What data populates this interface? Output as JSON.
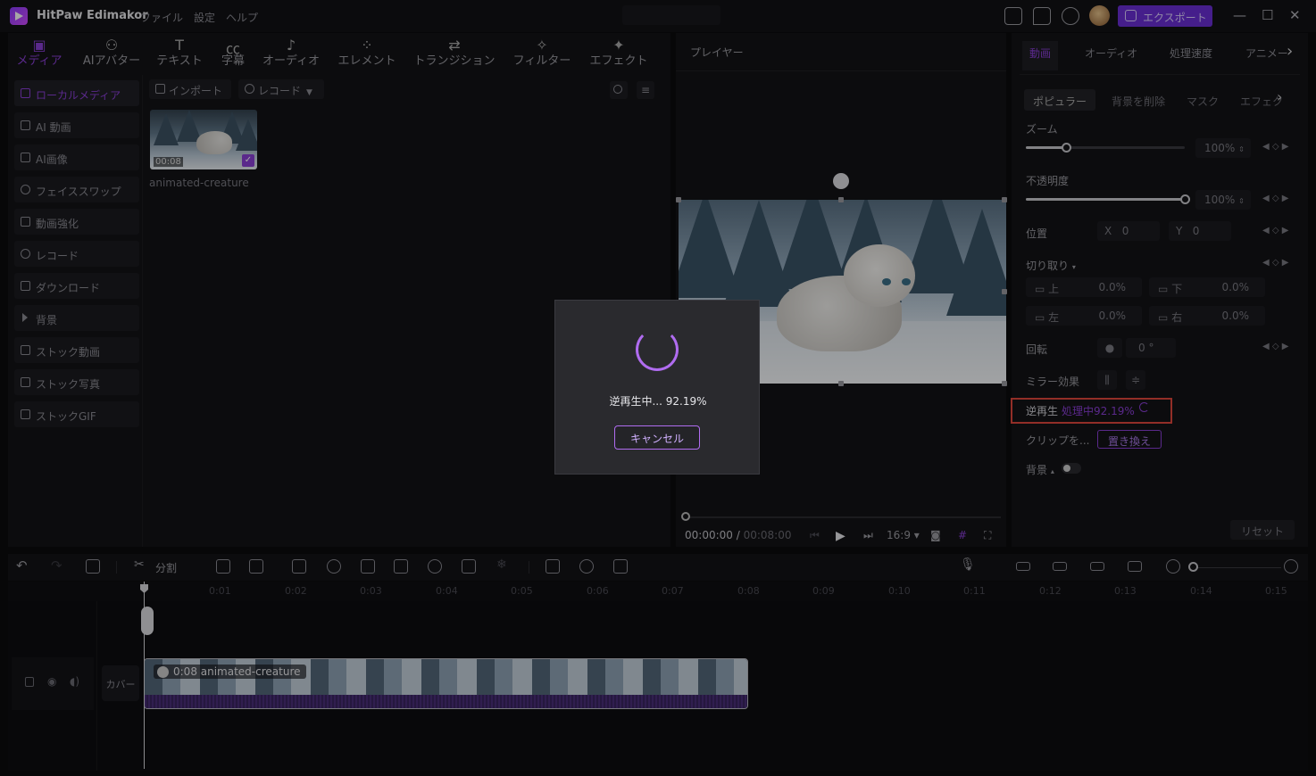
{
  "app": {
    "title": "HitPaw Edimakor",
    "menus": [
      "ファイル",
      "設定",
      "ヘルプ"
    ],
    "export_label": "エクスポート"
  },
  "media_tabs": [
    {
      "label": "メディア",
      "icon": "media-icon",
      "active": true
    },
    {
      "label": "AIアバター",
      "icon": "ai-avatar-icon"
    },
    {
      "label": "テキスト",
      "icon": "text-icon"
    },
    {
      "label": "字幕",
      "icon": "subtitle-icon"
    },
    {
      "label": "オーディオ",
      "icon": "audio-icon"
    },
    {
      "label": "エレメント",
      "icon": "element-icon"
    },
    {
      "label": "トランジション",
      "icon": "transition-icon"
    },
    {
      "label": "フィルター",
      "icon": "filter-icon"
    },
    {
      "label": "エフェクト",
      "icon": "effect-icon"
    }
  ],
  "sidebar": [
    {
      "label": "ローカルメディア",
      "active": true
    },
    {
      "label": "AI 動画"
    },
    {
      "label": "AI画像"
    },
    {
      "label": "フェイススワップ"
    },
    {
      "label": "動画強化"
    },
    {
      "label": "レコード"
    },
    {
      "label": "ダウンロード"
    },
    {
      "label": "背景"
    },
    {
      "label": "ストック動画"
    },
    {
      "label": "ストック写真"
    },
    {
      "label": "ストックGIF"
    }
  ],
  "media_toolbar": {
    "import_label": "インポート",
    "record_label": "レコード"
  },
  "media_item": {
    "name": "animated-creature",
    "duration": "00:08"
  },
  "player": {
    "title": "プレイヤー",
    "current_time": "00:00:00",
    "total_time": "00:08:00",
    "ratio": "16:9"
  },
  "right_panel": {
    "tabs": [
      "動画",
      "オーディオ",
      "処理速度",
      "アニメー"
    ],
    "subtabs": [
      "ポピュラー",
      "背景を削除",
      "マスク",
      "エフェク"
    ],
    "zoom_label": "ズーム",
    "zoom_value": "100%",
    "zoom_level": 0.25,
    "opacity_label": "不透明度",
    "opacity_value": "100%",
    "opacity_level": 1.0,
    "position_label": "位置",
    "pos_x_label": "X",
    "pos_x": "0",
    "pos_y_label": "Y",
    "pos_y": "0",
    "crop_label": "切り取り",
    "crop_top_label": "上",
    "crop_top": "0.0%",
    "crop_bottom_label": "下",
    "crop_bottom": "0.0%",
    "crop_left_label": "左",
    "crop_left": "0.0%",
    "crop_right_label": "右",
    "crop_right": "0.0%",
    "rotate_label": "回転",
    "rotate_value": "0",
    "rotate_unit": "°",
    "mirror_label": "ミラー効果",
    "reverse_label": "逆再生",
    "reverse_status": "処理中92.19%",
    "clip_label": "クリップを...",
    "replace_label": "置き換え",
    "background_label": "背景",
    "reset_label": "リセット"
  },
  "timeline": {
    "split_label": "分割",
    "ticks": [
      "0:01",
      "0:02",
      "0:03",
      "0:04",
      "0:05",
      "0:06",
      "0:07",
      "0:08",
      "0:09",
      "0:10",
      "0:11",
      "0:12",
      "0:13",
      "0:14",
      "0:15"
    ],
    "cover_label": "カバー",
    "clip_label": "0:08 animated-creature"
  },
  "dialog": {
    "progress_text": "逆再生中... 92.19%",
    "cancel_label": "キャンセル"
  },
  "colors": {
    "accent": "#8a3fd6",
    "highlight_box": "#e0483c"
  }
}
